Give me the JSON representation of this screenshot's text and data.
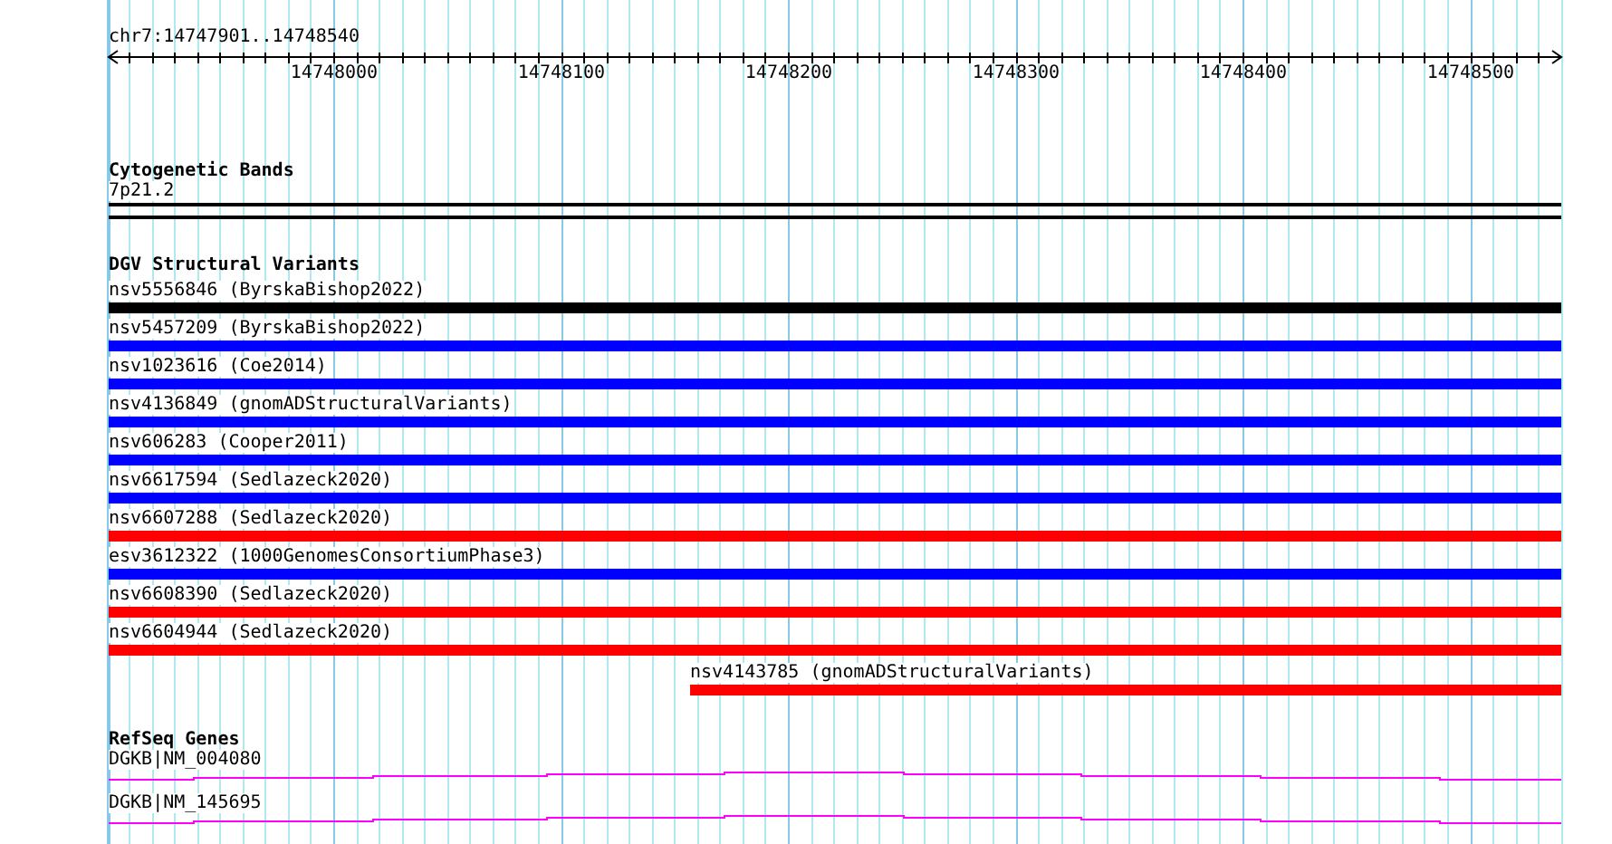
{
  "location": "chr7:14747901..14748540",
  "ruler": {
    "ticks": [
      "14748000",
      "14748100",
      "14748200",
      "14748300",
      "14748400",
      "14748500"
    ]
  },
  "tracks": [
    {
      "kind": "cytoband",
      "title": "Cytogenetic Bands",
      "band": "7p21.2"
    },
    {
      "kind": "variants",
      "title": "DGV Structural Variants",
      "features": [
        {
          "label": "nsv5556846 (ByrskaBishop2022)",
          "color": "#000000",
          "kind": "full"
        },
        {
          "label": "nsv5457209 (ByrskaBishop2022)",
          "color": "#0000ff",
          "kind": "full"
        },
        {
          "label": "nsv1023616 (Coe2014)",
          "color": "#0000ff",
          "kind": "full"
        },
        {
          "label": "nsv4136849 (gnomADStructuralVariants)",
          "color": "#0000ff",
          "kind": "full"
        },
        {
          "label": "nsv606283 (Cooper2011)",
          "color": "#0000ff",
          "kind": "full"
        },
        {
          "label": "nsv6617594 (Sedlazeck2020)",
          "color": "#0000ff",
          "kind": "full"
        },
        {
          "label": "nsv6607288 (Sedlazeck2020)",
          "color": "#ff0000",
          "kind": "full"
        },
        {
          "label": "esv3612322 (1000GenomesConsortiumPhase3)",
          "color": "#0000ff",
          "kind": "full"
        },
        {
          "label": "nsv6608390 (Sedlazeck2020)",
          "color": "#ff0000",
          "kind": "full"
        },
        {
          "label": "nsv6604944 (Sedlazeck2020)",
          "color": "#ff0000",
          "kind": "full"
        },
        {
          "label": "nsv4143785 (gnomADStructuralVariants)",
          "color": "#ff0000",
          "kind": "partial"
        }
      ]
    },
    {
      "kind": "genes",
      "title": "RefSeq Genes",
      "genes": [
        {
          "label": "DGKB|NM_004080"
        },
        {
          "label": "DGKB|NM_145695"
        }
      ]
    }
  ]
}
